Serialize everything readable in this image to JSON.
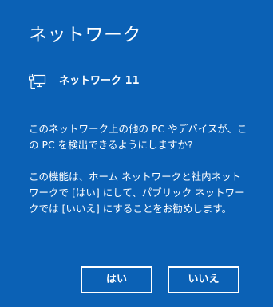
{
  "dialog": {
    "title": "ネットワーク",
    "network_icon": "ethernet-network-icon",
    "network_name": "ネットワーク 11",
    "message_1": "このネットワーク上の他の PC やデバイスが、この PC を検出できるようにしますか?",
    "message_2": "この機能は、ホーム ネットワークと社内ネットワークで [はい] にして、パブリック ネットワークでは [いいえ] にすることをお勧めします。"
  },
  "buttons": {
    "yes_label": "はい",
    "no_label": "いいえ"
  },
  "colors": {
    "background": "#0b61b5",
    "foreground": "#ffffff"
  }
}
